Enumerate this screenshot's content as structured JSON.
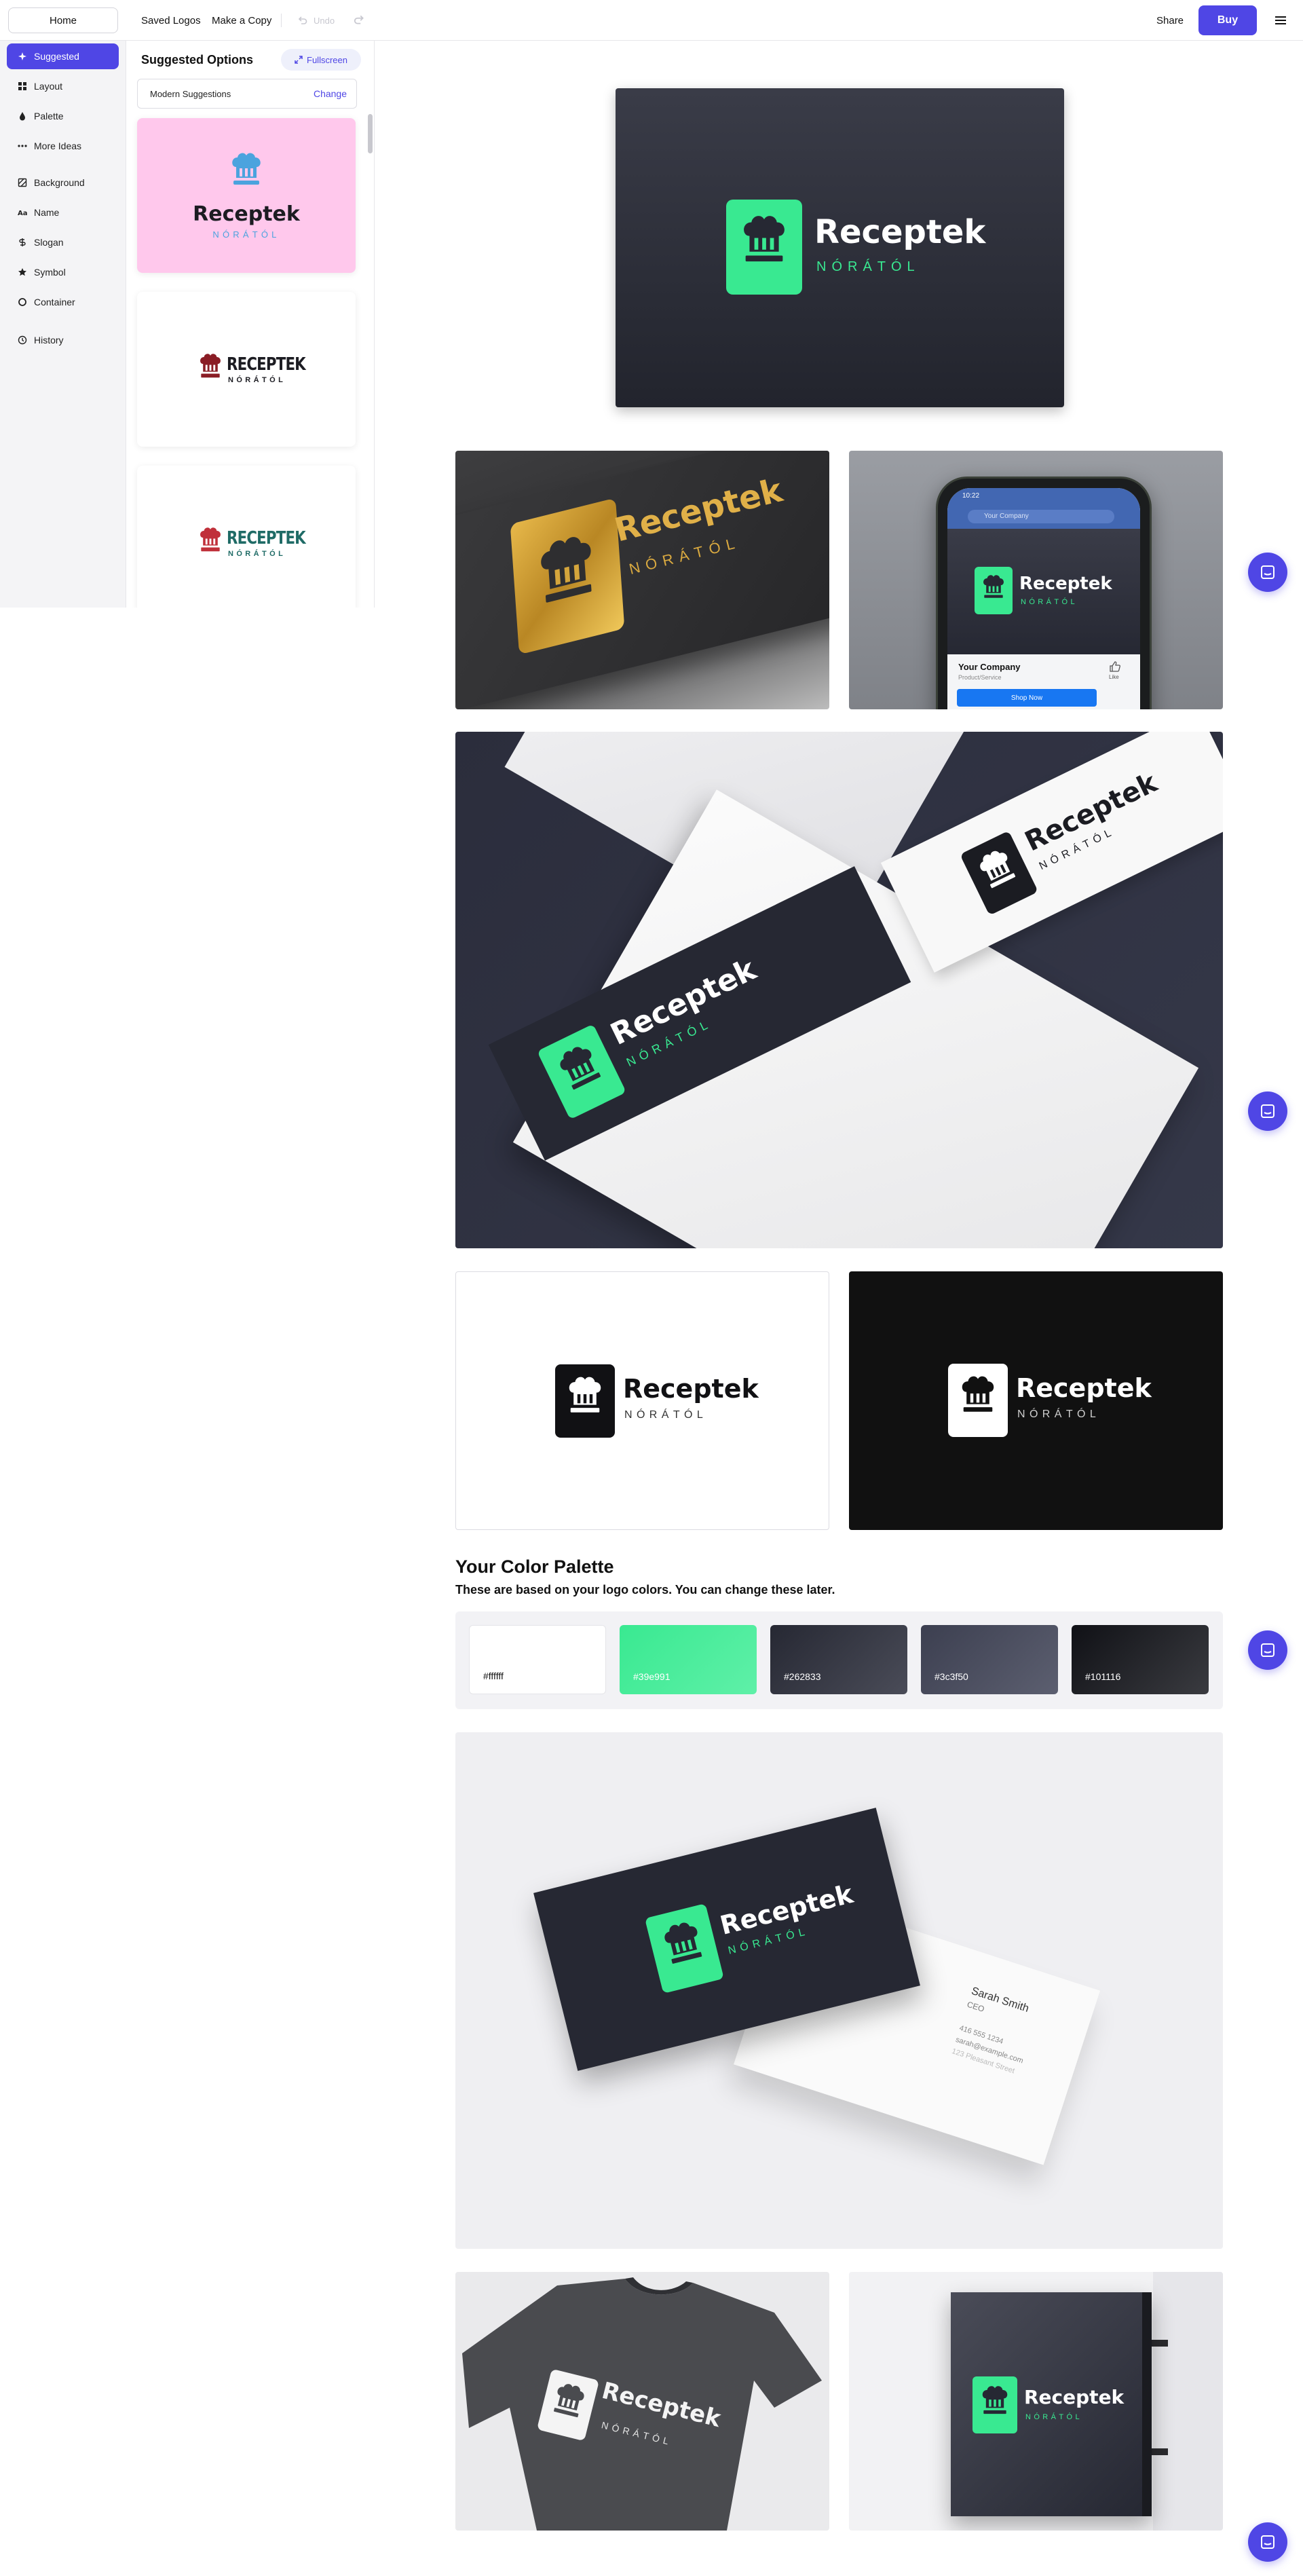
{
  "topbar": {
    "home": "Home",
    "saved_logos": "Saved Logos",
    "make_copy": "Make a Copy",
    "undo": "Undo",
    "share": "Share",
    "buy": "Buy"
  },
  "sidebar": {
    "items": [
      {
        "label": "Suggested",
        "icon": "sparkle-icon"
      },
      {
        "label": "Layout",
        "icon": "layout-icon"
      },
      {
        "label": "Palette",
        "icon": "droplet-icon"
      },
      {
        "label": "More Ideas",
        "icon": "dots-icon"
      },
      {
        "label": "Background",
        "icon": "background-icon"
      },
      {
        "label": "Name",
        "icon": "text-icon"
      },
      {
        "label": "Slogan",
        "icon": "slogan-icon"
      },
      {
        "label": "Symbol",
        "icon": "star-icon"
      },
      {
        "label": "Container",
        "icon": "circle-icon"
      },
      {
        "label": "History",
        "icon": "clock-icon"
      }
    ]
  },
  "panel": {
    "title": "Suggested Options",
    "fullscreen": "Fullscreen",
    "filter": "Modern Suggestions",
    "change": "Change",
    "cards": [
      {
        "name": "Receptek",
        "sub": "NÓRÁTÓL",
        "bg": "#ffc8ec",
        "icon_color": "#4ba3de",
        "text_color": "#1c1c22",
        "sub_color": "#4ba3de"
      },
      {
        "name": "RECEPTEK",
        "sub": "NÓRÁTÓL",
        "bg": "#ffffff",
        "icon_color": "#8a1d25",
        "text_color": "#1c1c22",
        "sub_color": "#1c1c22"
      },
      {
        "name": "RECEPTEK",
        "sub": "NÓRÁTÓL",
        "bg": "#ffffff",
        "icon_color": "#c0303a",
        "text_color": "#1f6b66",
        "sub_color": "#1f6b66"
      }
    ]
  },
  "logo": {
    "name": "Receptek",
    "sub": "NÓRÁTÓL"
  },
  "mockups": {
    "phone_time": "10:22",
    "phone_search": "Your Company",
    "phone_company": "Your Company",
    "phone_category": "Product/Service",
    "phone_like": "Like",
    "phone_shop": "Shop Now",
    "card_person": "Sarah Smith",
    "card_role": "CEO",
    "card_phone": "416 555 1234",
    "card_email": "sarah@example.com",
    "card_address": "123 Pleasant Street"
  },
  "palette": {
    "title": "Your Color Palette",
    "subtitle": "These are based on your logo colors. You can change these later.",
    "colors": [
      {
        "hex": "#ffffff",
        "label": "#ffffff",
        "text": "#111111"
      },
      {
        "hex": "#39e991",
        "label": "#39e991",
        "text": "#ffffff"
      },
      {
        "hex": "#262833",
        "label": "#262833",
        "text": "#ffffff"
      },
      {
        "hex": "#3c3f50",
        "label": "#3c3f50",
        "text": "#ffffff"
      },
      {
        "hex": "#101116",
        "label": "#101116",
        "text": "#ffffff"
      }
    ]
  },
  "colors": {
    "accent": "#4f46e5",
    "brand_green": "#39e991",
    "dark": "#262833"
  }
}
